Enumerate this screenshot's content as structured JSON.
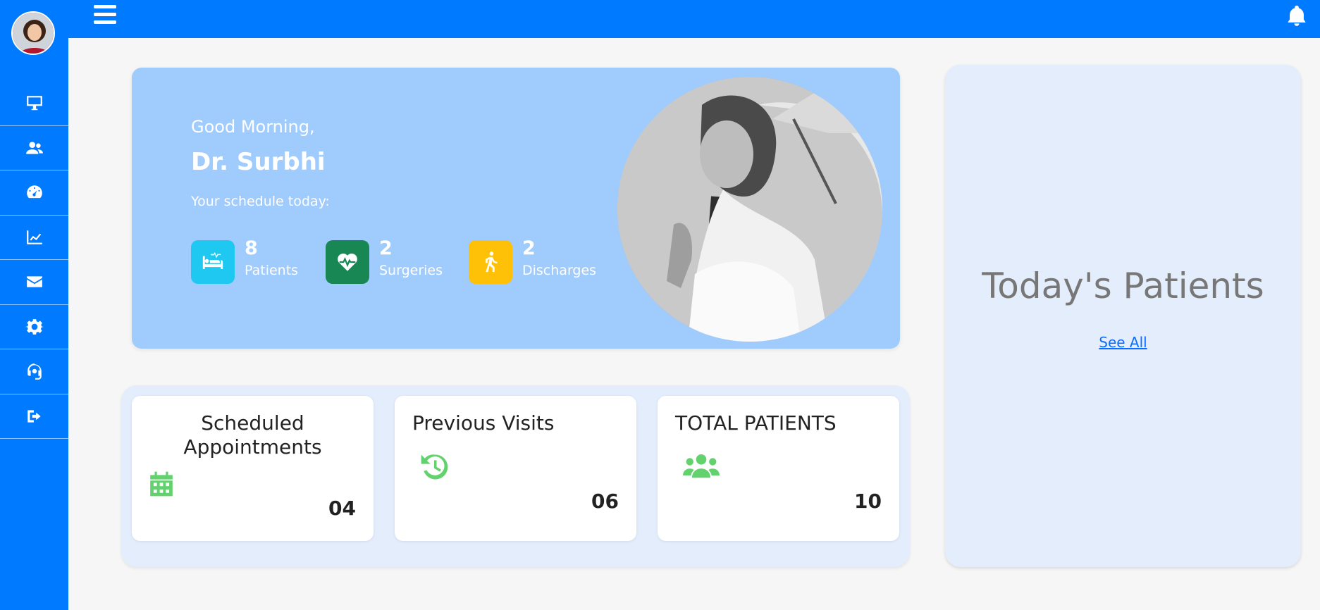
{
  "sidebar": {
    "avatar": "avatar",
    "items": [
      {
        "icon": "monitor-icon"
      },
      {
        "icon": "users-icon"
      },
      {
        "icon": "gauge-icon"
      },
      {
        "icon": "chart-line-icon"
      },
      {
        "icon": "envelope-icon"
      },
      {
        "icon": "gear-icon"
      },
      {
        "icon": "headset-icon"
      },
      {
        "icon": "sign-out-icon"
      }
    ]
  },
  "topbar": {
    "menu_icon": "hamburger-icon",
    "notification_icon": "bell-icon"
  },
  "welcome": {
    "greeting": "Good Morning,",
    "doctor_name": "Dr. Surbhi",
    "schedule_label": "Your schedule today:",
    "stats": [
      {
        "value": "8",
        "label": "Patients",
        "icon": "hospital-bed-icon",
        "color": "#1ec8f0"
      },
      {
        "value": "2",
        "label": "Surgeries",
        "icon": "heartbeat-icon",
        "color": "#198754"
      },
      {
        "value": "2",
        "label": "Discharges",
        "icon": "walking-icon",
        "color": "#ffc107"
      }
    ]
  },
  "cards": [
    {
      "title": "Scheduled Appointments",
      "value": "04",
      "icon": "calendar-icon"
    },
    {
      "title": "Previous Visits",
      "value": "06",
      "icon": "history-icon"
    },
    {
      "title": "TOTAL PATIENTS",
      "value": "10",
      "icon": "users-icon"
    }
  ],
  "today_patients": {
    "title": "Today's Patients",
    "link": "See All"
  },
  "colors": {
    "primary": "#007bff",
    "welcome_bg": "#9fcbfd",
    "panel_bg": "#e3edfb",
    "icon_green": "#63d26e"
  }
}
